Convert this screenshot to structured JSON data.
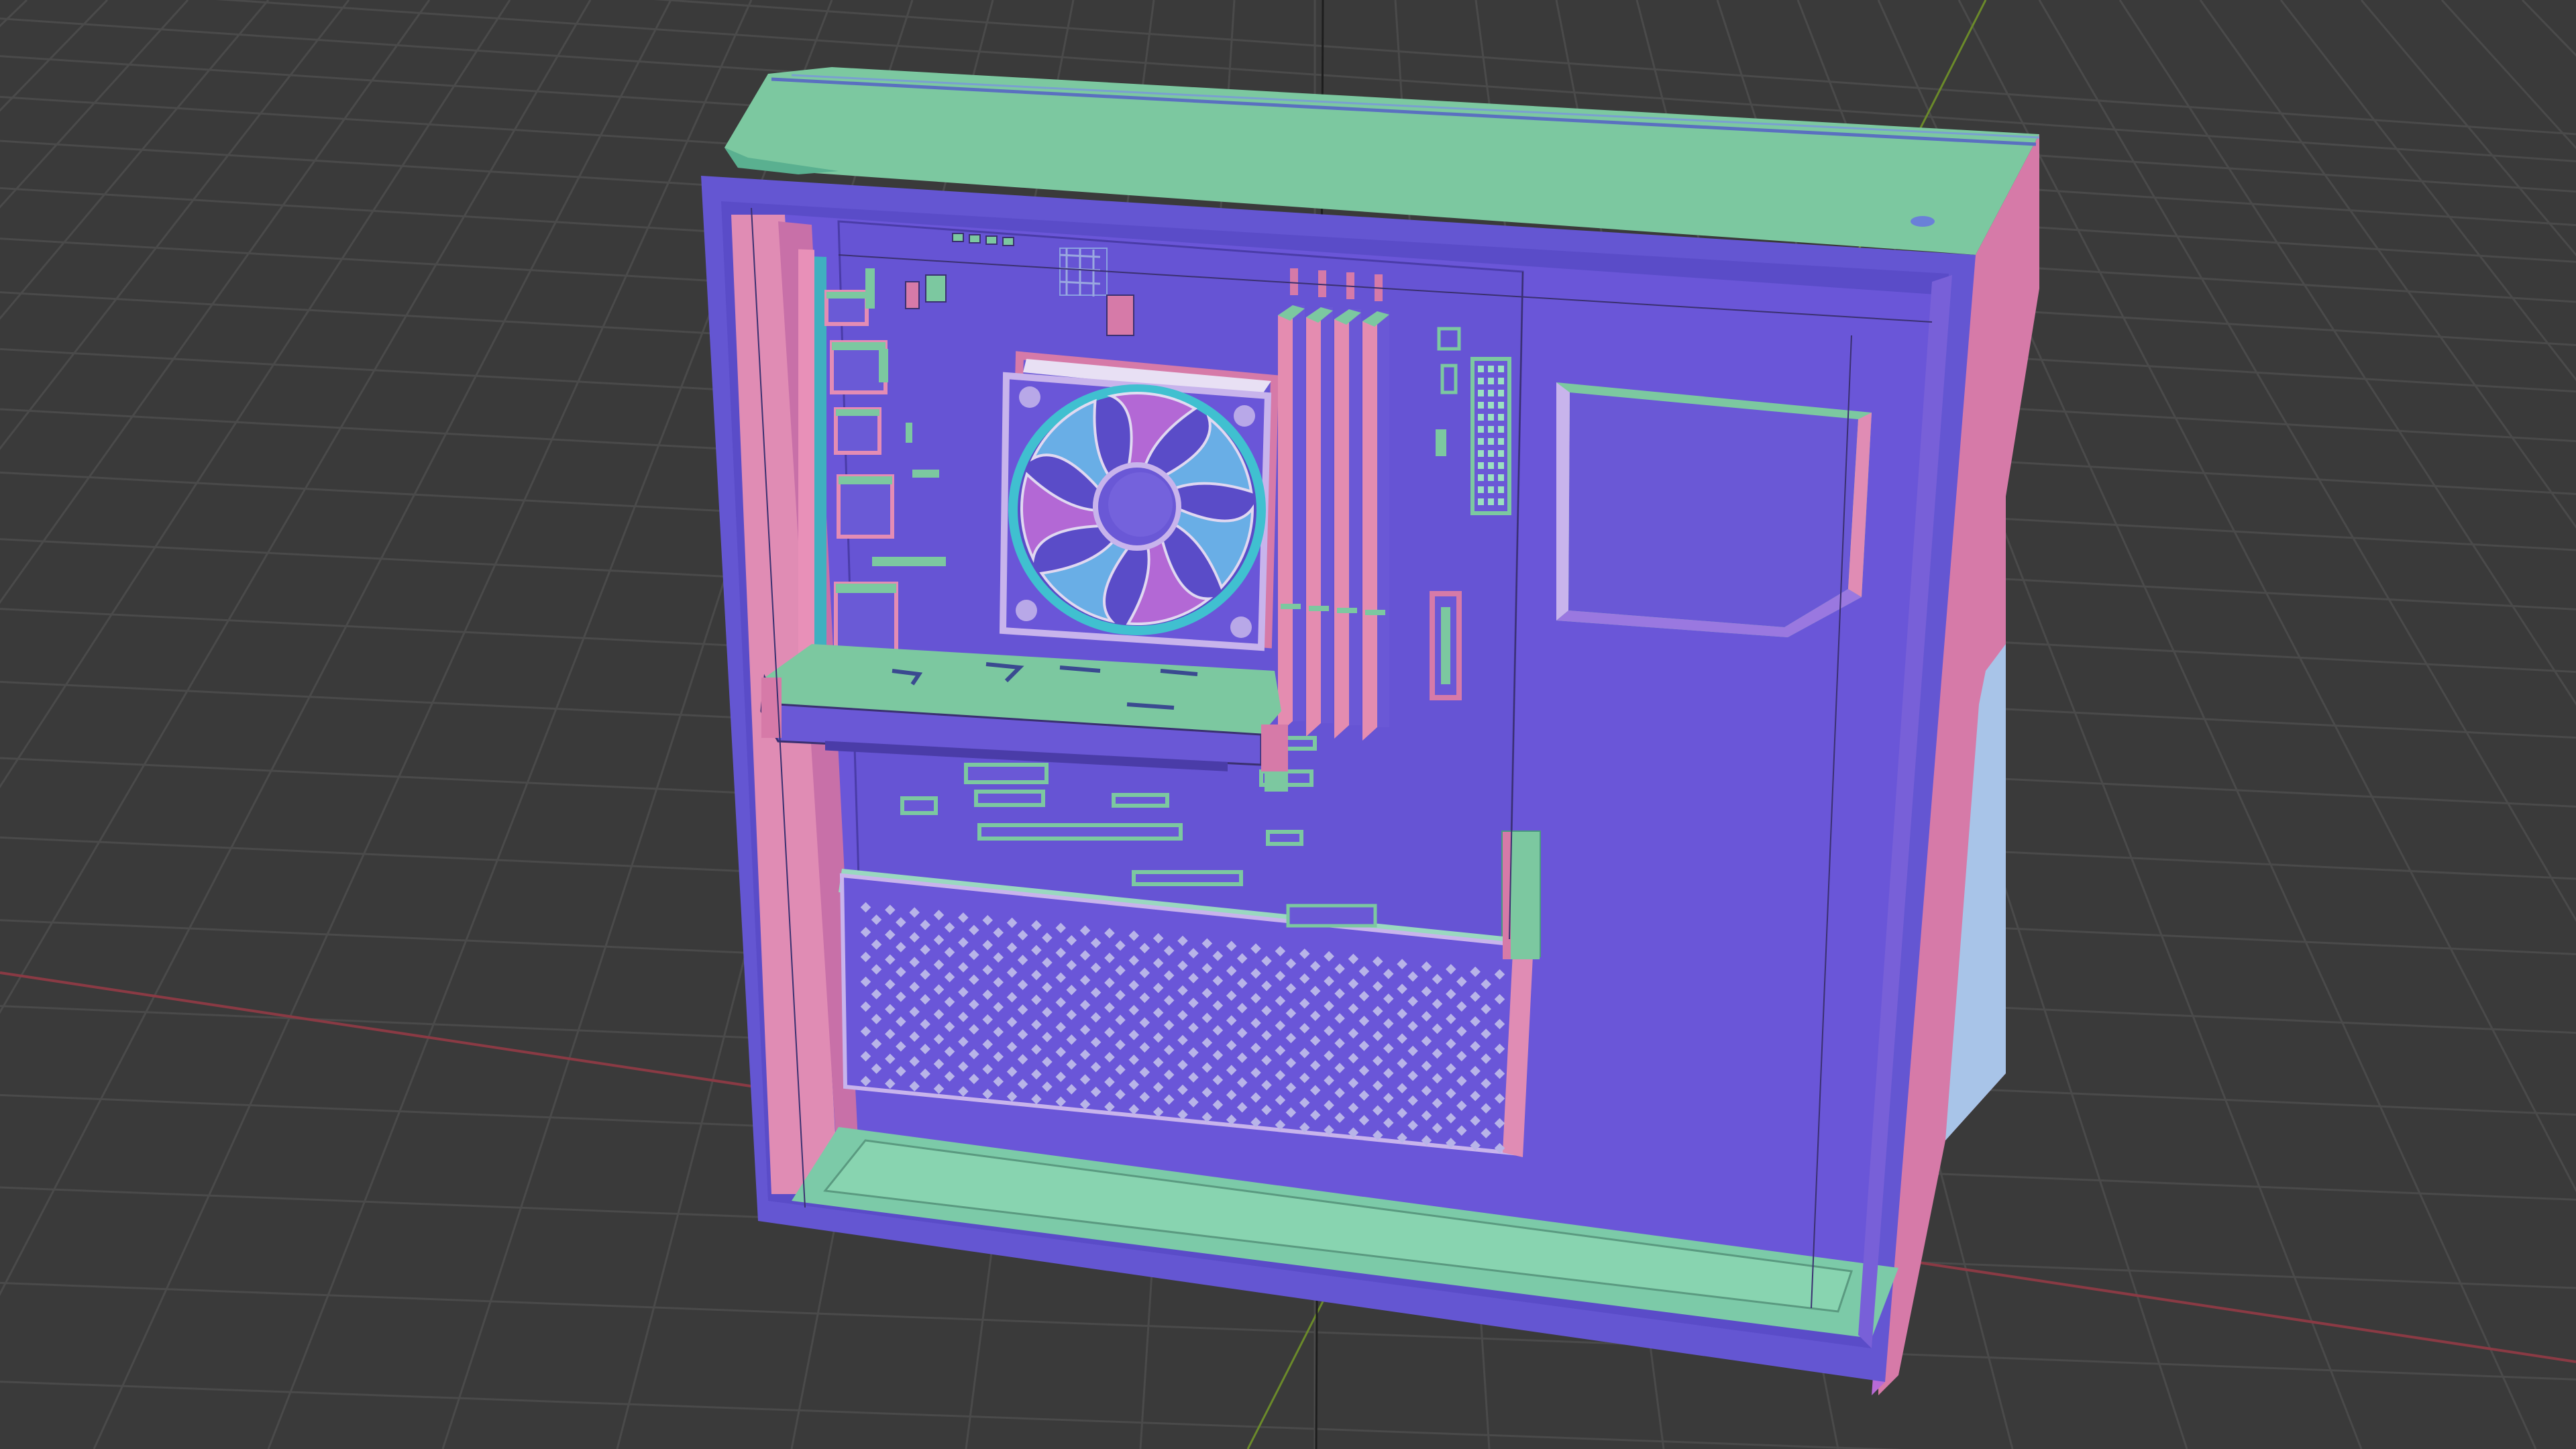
{
  "viewport": {
    "background": "#3a3a3a",
    "grid_color": "#4a4a4a",
    "x_axis_color": "#8a3a44",
    "y_axis_color": "#6b8a2a",
    "z_axis_color": "#1e1e1e"
  },
  "model": {
    "shading": "normal-map",
    "palette": {
      "front_face": "#6a58d6",
      "front_face_dark": "#5a48c8",
      "top_face": "#7cc8a0",
      "side_face": "#d67aa8",
      "side_face_light": "#e48cb0",
      "bottom_face": "#7ccaa8",
      "mesh_dot": "#b8b4e8",
      "fan_blade": "#b86ad6",
      "fan_blade_alt": "#6ab4e8",
      "edge_line": "#3a3070"
    },
    "components": [
      "pc-case",
      "motherboard",
      "cpu-cooler-fan",
      "ram-sticks",
      "graphics-card",
      "psu-shroud",
      "drive-cage",
      "power-button"
    ]
  }
}
